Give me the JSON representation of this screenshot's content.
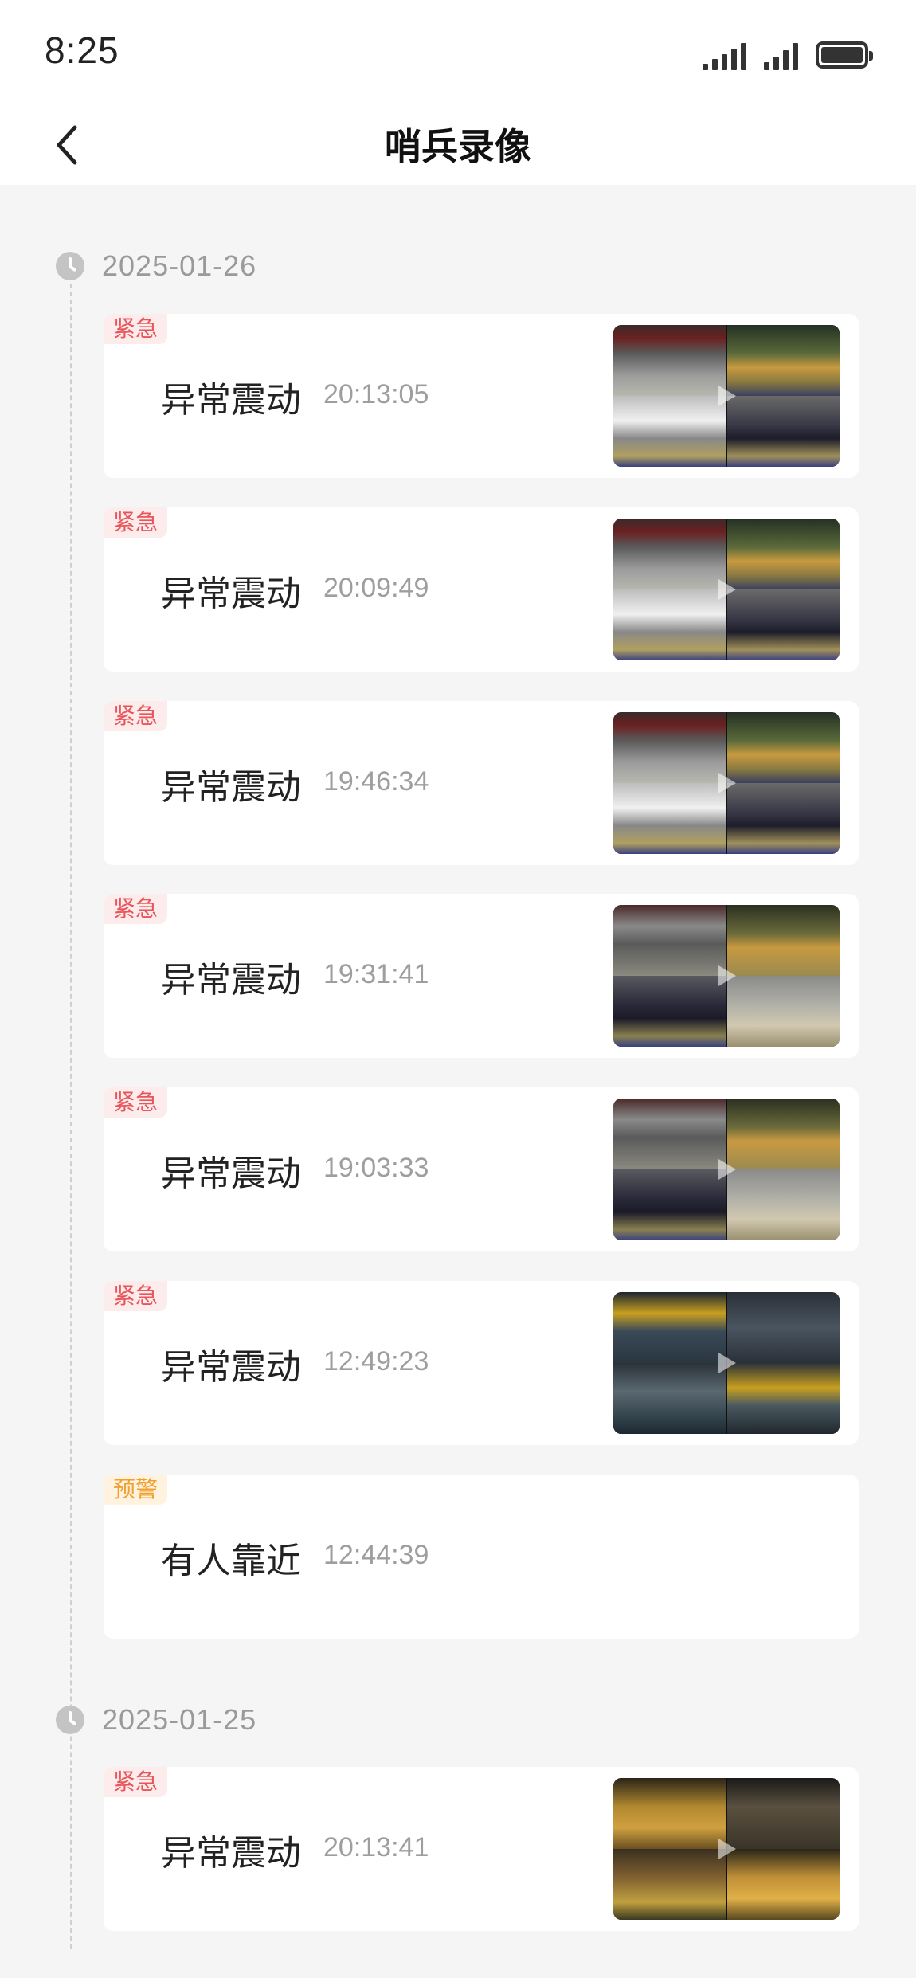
{
  "status_bar": {
    "time": "8:25"
  },
  "header": {
    "title": "哨兵录像"
  },
  "groups": [
    {
      "date": "2025-01-26",
      "events": [
        {
          "tag": "紧急",
          "tag_type": "urgent",
          "name": "异常震动",
          "time": "20:13:05",
          "has_thumbnail": true
        },
        {
          "tag": "紧急",
          "tag_type": "urgent",
          "name": "异常震动",
          "time": "20:09:49",
          "has_thumbnail": true
        },
        {
          "tag": "紧急",
          "tag_type": "urgent",
          "name": "异常震动",
          "time": "19:46:34",
          "has_thumbnail": true
        },
        {
          "tag": "紧急",
          "tag_type": "urgent",
          "name": "异常震动",
          "time": "19:31:41",
          "has_thumbnail": true
        },
        {
          "tag": "紧急",
          "tag_type": "urgent",
          "name": "异常震动",
          "time": "19:03:33",
          "has_thumbnail": true
        },
        {
          "tag": "紧急",
          "tag_type": "urgent",
          "name": "异常震动",
          "time": "12:49:23",
          "has_thumbnail": true
        },
        {
          "tag": "预警",
          "tag_type": "warning",
          "name": "有人靠近",
          "time": "12:44:39",
          "has_thumbnail": false
        }
      ]
    },
    {
      "date": "2025-01-25",
      "events": [
        {
          "tag": "紧急",
          "tag_type": "urgent",
          "name": "异常震动",
          "time": "20:13:41",
          "has_thumbnail": true
        }
      ]
    }
  ],
  "colors": {
    "urgent": "#e8555a",
    "warning": "#f0a030",
    "background": "#f5f5f5"
  },
  "icons": [
    "back-arrow-icon",
    "clock-icon",
    "play-icon",
    "signal-icon",
    "battery-icon"
  ]
}
